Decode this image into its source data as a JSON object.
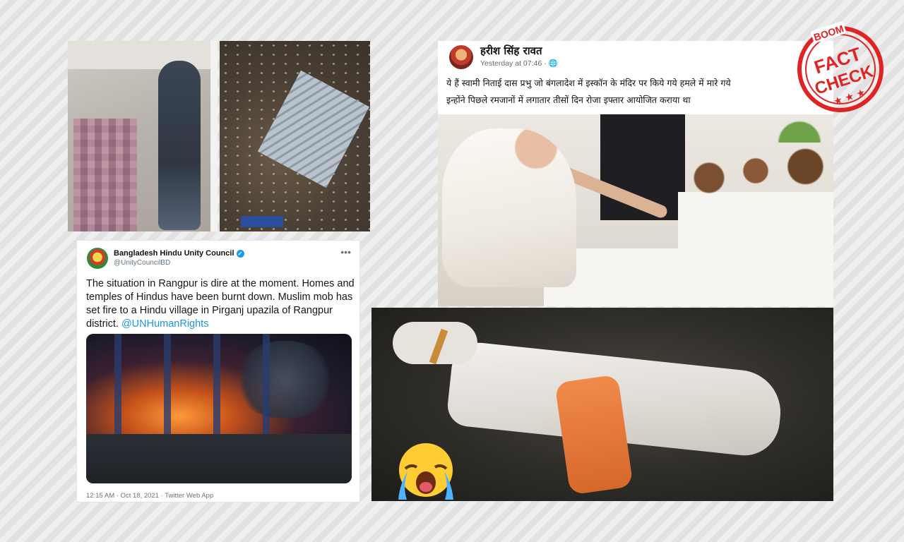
{
  "tweet": {
    "author_name": "Bangladesh Hindu Unity Council",
    "handle": "@UnityCouncilBD",
    "more_icon": "•••",
    "text": "The situation in Rangpur is dire at the moment. Homes and temples of Hindus have been burnt down. Muslim mob has set fire to a Hindu village in Pirganj upazila of Rangpur district.",
    "mention": "@UNHumanRights",
    "meta": "12:15 AM · Oct 18, 2021 · Twitter Web App"
  },
  "facebook_post": {
    "author_name": "हरीश सिंह रावत",
    "timestamp": "Yesterday at 07:46 ·",
    "line1": "ये हैं स्वामी निताई दास प्रभु जो बंगलादेश में इस्कॉन के मंदिर पर किये गये हमले में मारे गये",
    "line2": "इन्होंने पिछले रमजानों में लगातार तीसों दिन रोजा इफ्तार आयोजित कराया था"
  },
  "stamp": {
    "brand": "BOOM",
    "word1": "FACT",
    "word2": "CHECK",
    "color": "#e02424"
  },
  "colors": {
    "twitter_link": "#1b95e0",
    "verified": "#1d9bf0"
  }
}
